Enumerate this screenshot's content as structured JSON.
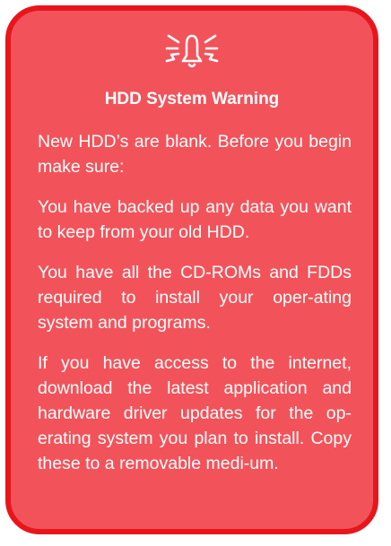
{
  "warning": {
    "icon": "alarm-bell-icon",
    "title": "HDD System Warning",
    "paragraphs": [
      "New HDD’s are blank. Before you begin make sure:",
      "You have backed up any data you want to keep from your old HDD.",
      "You have all the CD-ROMs and FDDs required to install your oper-ating system and programs.",
      "If you have access to the internet, download the latest application and hardware driver updates for the op-erating system you plan to install. Copy these to a removable medi-um."
    ]
  },
  "colors": {
    "card_fill": "#f2535a",
    "card_border": "#e8161c",
    "text": "#ffffff"
  }
}
